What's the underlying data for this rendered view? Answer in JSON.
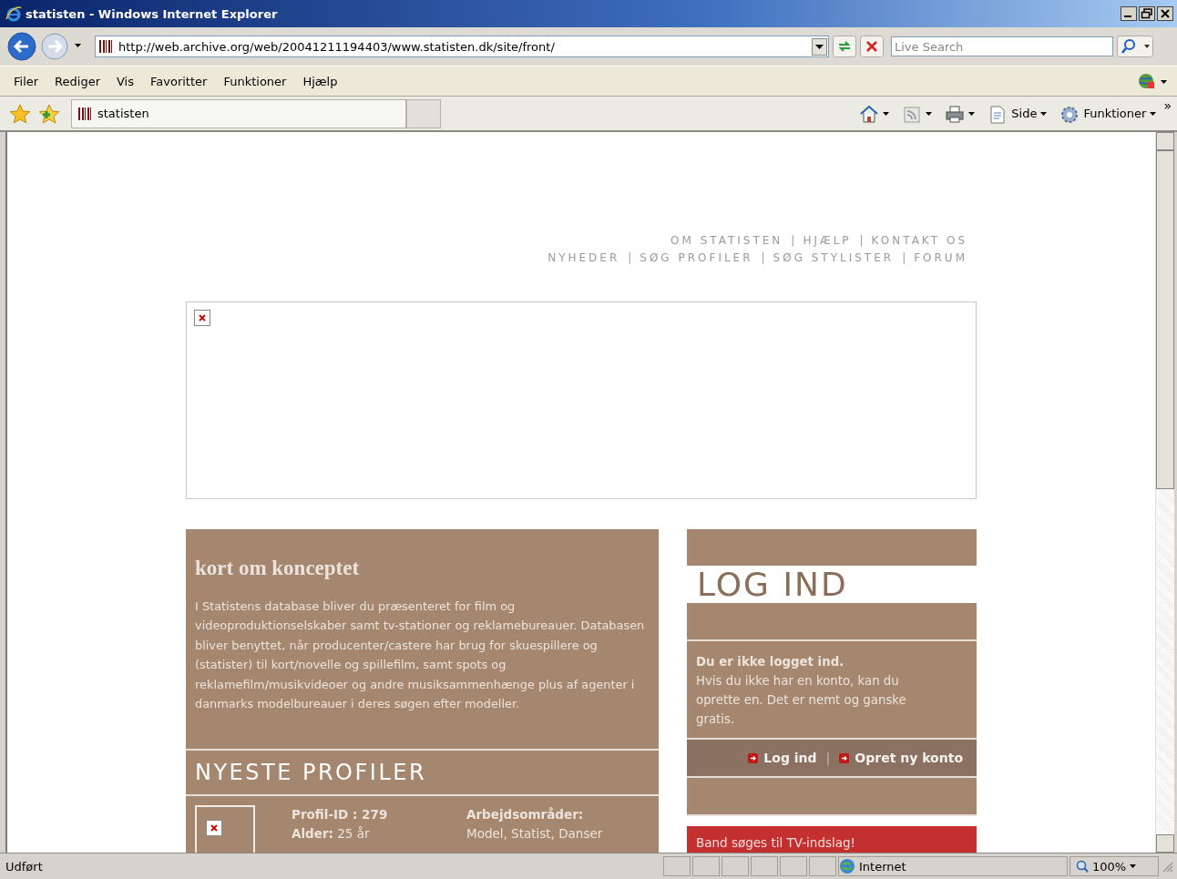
{
  "window": {
    "title": "statisten - Windows Internet Explorer"
  },
  "address": {
    "url": "http://web.archive.org/web/20041211194403/www.statisten.dk/site/front/"
  },
  "search": {
    "placeholder": "Live Search"
  },
  "menu": [
    "Filer",
    "Rediger",
    "Vis",
    "Favoritter",
    "Funktioner",
    "Hjælp"
  ],
  "tab": {
    "title": "statisten"
  },
  "command_bar": [
    {
      "kind": "home"
    },
    {
      "kind": "feeds"
    },
    {
      "kind": "print"
    },
    {
      "kind": "page",
      "label": "Side"
    },
    {
      "kind": "tools",
      "label": "Funktioner"
    }
  ],
  "command_bar_overflow": "»",
  "page": {
    "top_links_separator": "|",
    "top_links": [
      [
        "OM STATISTEN",
        "HJÆLP",
        "KONTAKT OS"
      ],
      [
        "NYHEDER",
        "SØG PROFILER",
        "SØG STYLISTER",
        "FORUM"
      ]
    ],
    "concept": {
      "title": "kort om konceptet",
      "text": "I Statistens database bliver du præsenteret for film og videoproduktionselskaber samt tv-stationer og reklamebureauer. Databasen bliver benyttet, når producenter/castere har brug for skuespillere og (statister) til kort/novelle og spillefilm, samt spots og reklamefilm/musikvideoer og andre musiksammenhænge plus af agenter i danmarks modelbureauer i deres søgen efter modeller."
    },
    "profiles": {
      "title": "NYESTE PROFILER",
      "items": [
        {
          "id": "Profil-ID : 279",
          "age": "**Alder:** 25 år",
          "areas_label": "Arbejdsområder:",
          "areas": "Model, Statist, Danser"
        }
      ]
    },
    "login": {
      "title": "LOG IND",
      "notice_title": "Du er ikke logget ind.",
      "notice_text": "Hvis du ikke har en konto, kan du oprette en. Det er nemt og ganske gratis.",
      "links": [
        "Log ind",
        "Opret ny konto"
      ],
      "links_separator": "|"
    },
    "notice": {
      "text": "Band søges til TV-indslag!"
    }
  },
  "status_bar": {
    "text": "Udført",
    "zone": "Internet",
    "zoom": "100%"
  }
}
